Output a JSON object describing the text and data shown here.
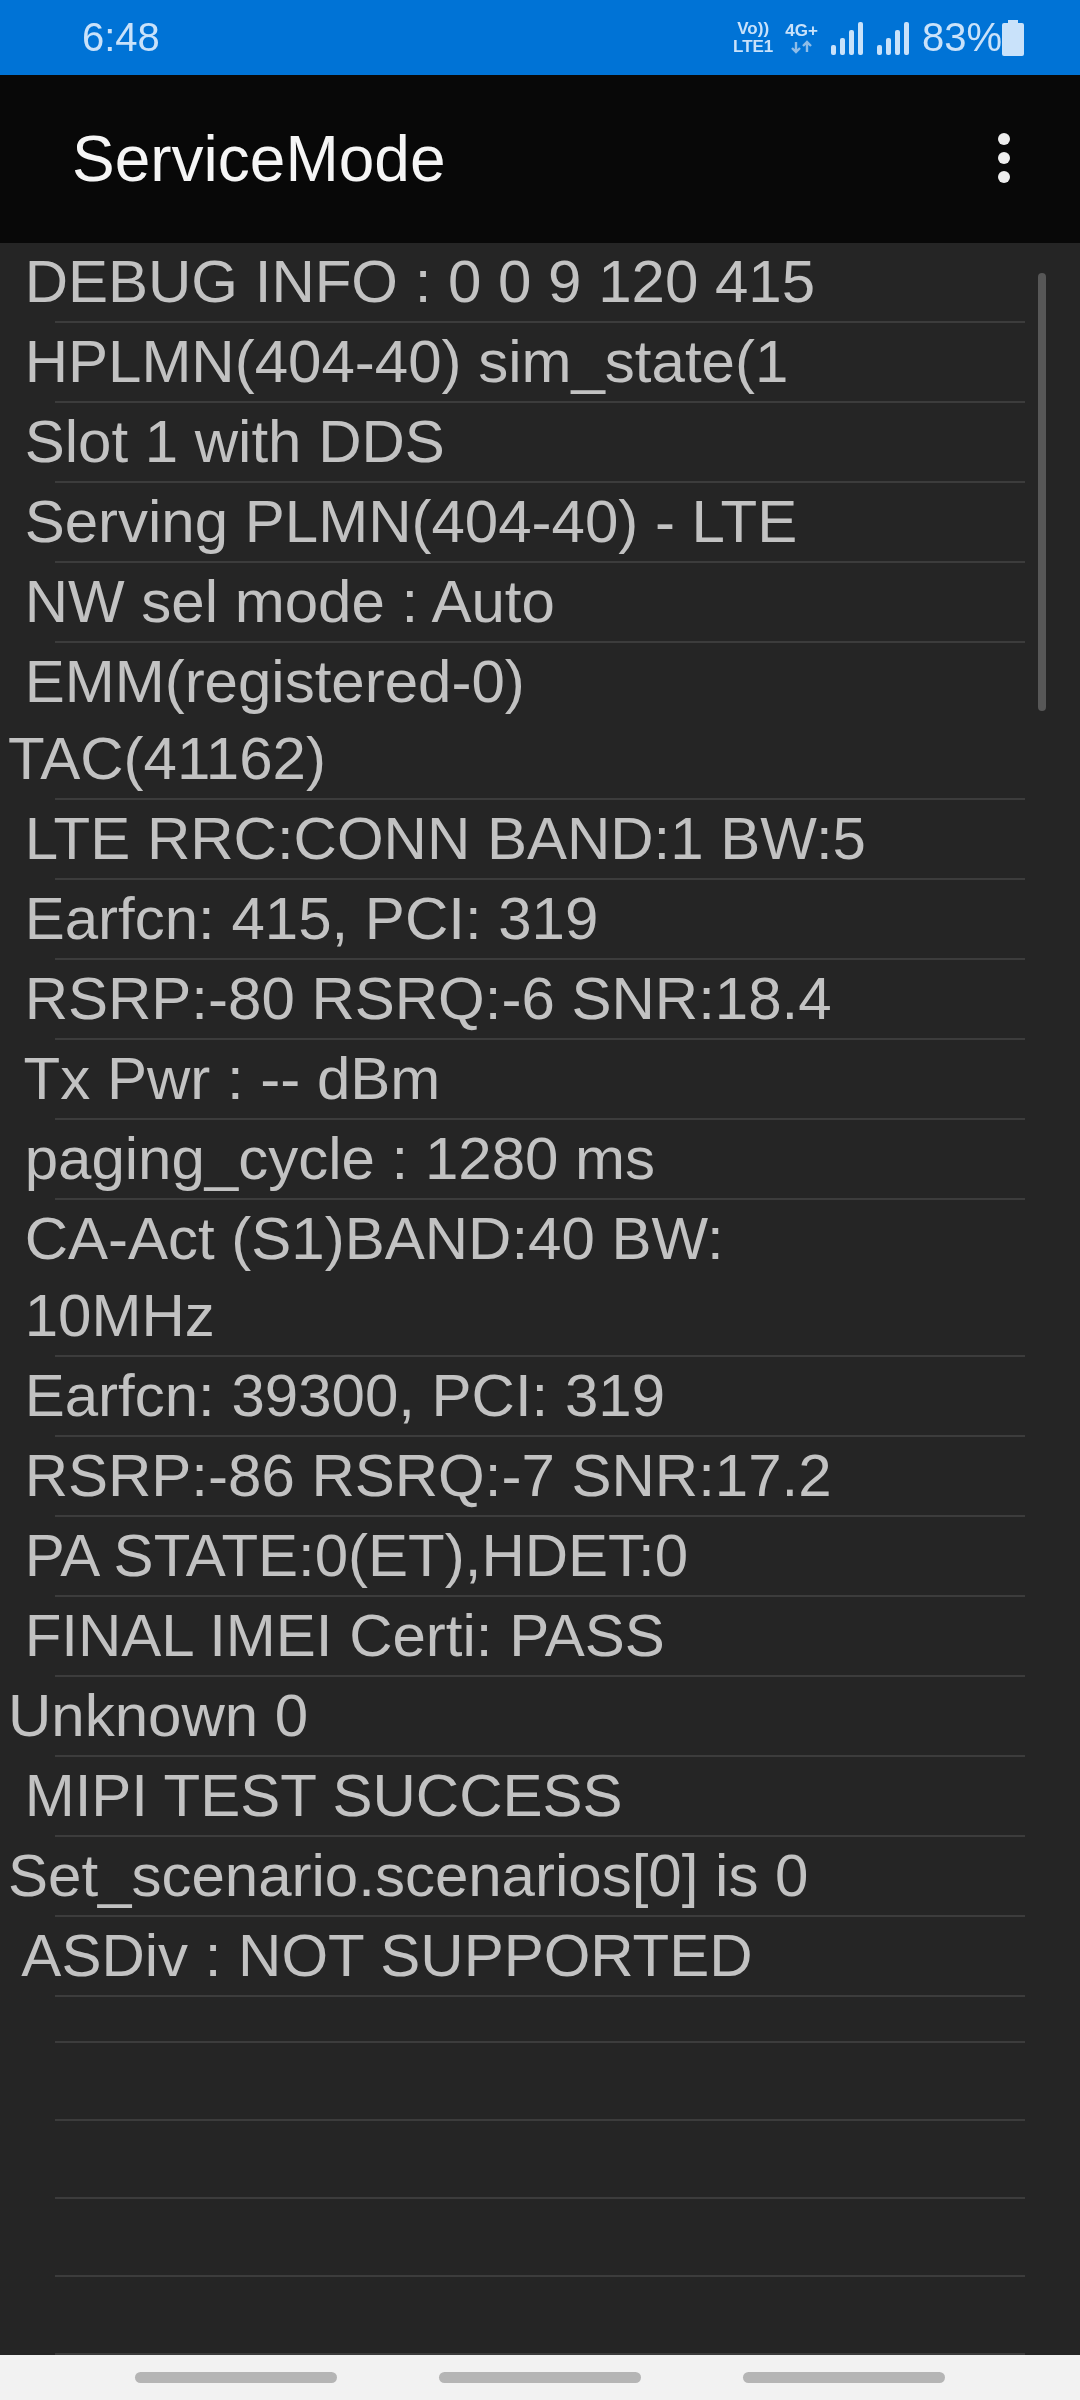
{
  "status_bar": {
    "time": "6:48",
    "volte": "Vo))",
    "lte_slot": "LTE1",
    "network": "4G+",
    "battery": "83%"
  },
  "app_bar": {
    "title": "ServiceMode"
  },
  "rows": [
    {
      "lines": [
        " DEBUG INFO : 0 0 9 120 415"
      ]
    },
    {
      "lines": [
        " HPLMN(404-40) sim_state(1"
      ]
    },
    {
      "lines": [
        " Slot 1 with DDS"
      ]
    },
    {
      "lines": [
        " Serving PLMN(404-40) - LTE"
      ]
    },
    {
      "lines": [
        " NW sel mode : Auto"
      ]
    },
    {
      "lines": [
        " EMM(registered-0)",
        "TAC(41162)"
      ]
    },
    {
      "lines": [
        " LTE RRC:CONN BAND:1 BW:5"
      ]
    },
    {
      "lines": [
        " Earfcn: 415, PCI: 319"
      ]
    },
    {
      "lines": [
        " RSRP:-80 RSRQ:-6 SNR:18.4"
      ]
    },
    {
      "lines": [
        " Tx Pwr : -- dBm"
      ]
    },
    {
      "lines": [
        " paging_cycle : 1280 ms"
      ]
    },
    {
      "lines": [
        " CA-Act (S1)BAND:40 BW:",
        " 10MHz"
      ]
    },
    {
      "lines": [
        " Earfcn: 39300, PCI: 319"
      ]
    },
    {
      "lines": [
        " RSRP:-86 RSRQ:-7 SNR:17.2"
      ]
    },
    {
      "lines": [
        " PA STATE:0(ET),HDET:0"
      ]
    },
    {
      "lines": [
        " FINAL IMEI Certi: PASS"
      ]
    },
    {
      "lines": [
        "Unknown 0"
      ]
    },
    {
      "lines": [
        " MIPI TEST SUCCESS"
      ]
    },
    {
      "lines": [
        "Set_scenario.scenarios[0] is 0"
      ]
    },
    {
      "lines": [
        " ASDiv : NOT SUPPORTED"
      ]
    }
  ]
}
